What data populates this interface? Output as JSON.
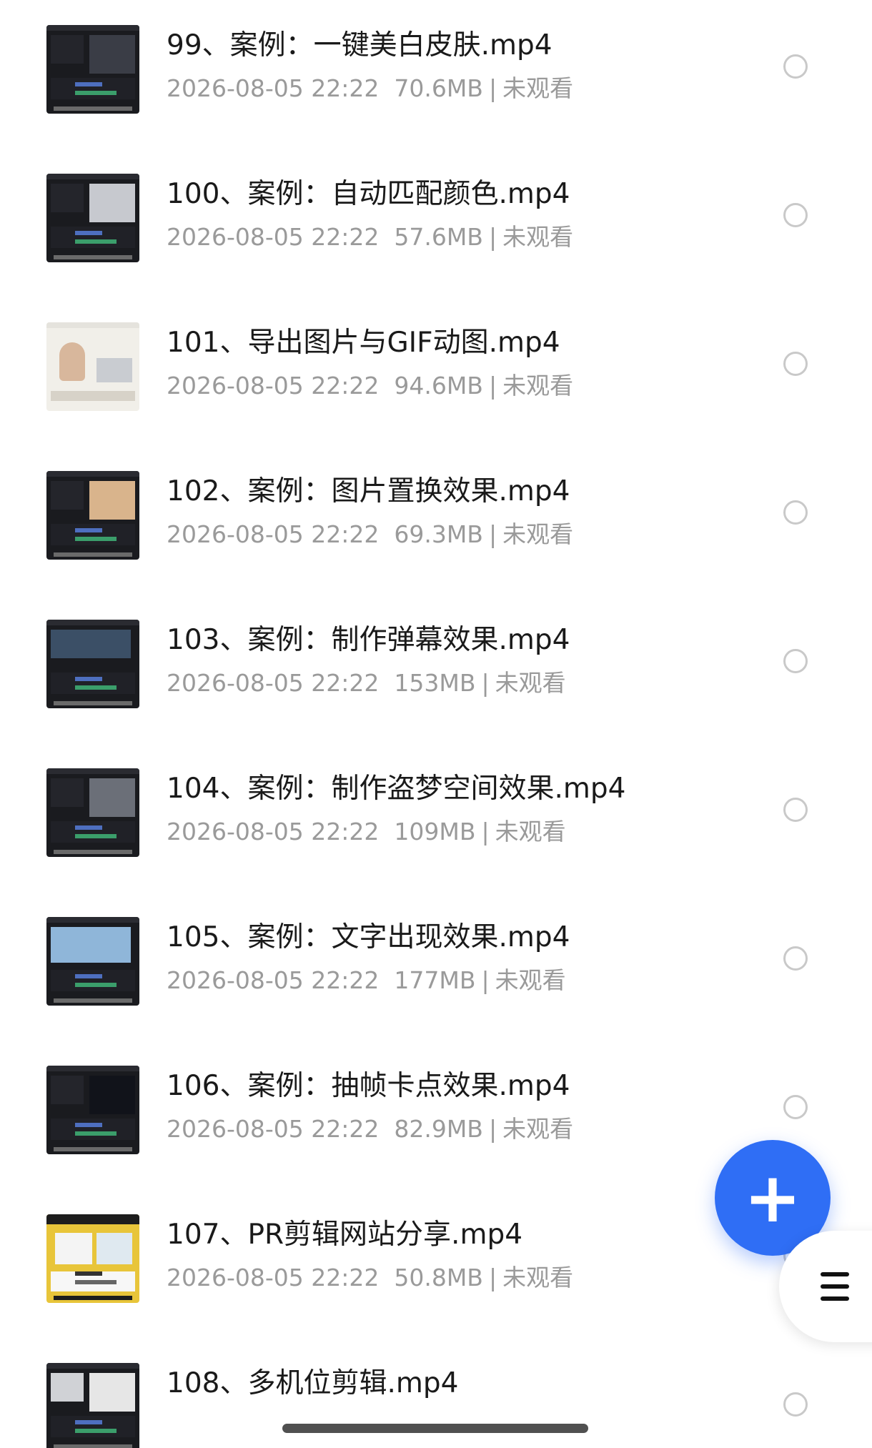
{
  "files": [
    {
      "title": "99、案例：一键美白皮肤.mp4",
      "date": "2026-08-05 22:22",
      "size": "70.6MB",
      "status": "未观看"
    },
    {
      "title": "100、案例：自动匹配颜色.mp4",
      "date": "2026-08-05 22:22",
      "size": "57.6MB",
      "status": "未观看"
    },
    {
      "title": "101、导出图片与GIF动图.mp4",
      "date": "2026-08-05 22:22",
      "size": "94.6MB",
      "status": "未观看"
    },
    {
      "title": "102、案例：图片置换效果.mp4",
      "date": "2026-08-05 22:22",
      "size": "69.3MB",
      "status": "未观看"
    },
    {
      "title": "103、案例：制作弹幕效果.mp4",
      "date": "2026-08-05 22:22",
      "size": "153MB",
      "status": "未观看"
    },
    {
      "title": "104、案例：制作盗梦空间效果.mp4",
      "date": "2026-08-05 22:22",
      "size": "109MB",
      "status": "未观看"
    },
    {
      "title": "105、案例：文字出现效果.mp4",
      "date": "2026-08-05 22:22",
      "size": "177MB",
      "status": "未观看"
    },
    {
      "title": "106、案例：抽帧卡点效果.mp4",
      "date": "2026-08-05 22:22",
      "size": "82.9MB",
      "status": "未观看"
    },
    {
      "title": "107、PR剪辑网站分享.mp4",
      "date": "2026-08-05 22:22",
      "size": "50.8MB",
      "status": "未观看"
    },
    {
      "title": "108、多机位剪辑.mp4",
      "date": "",
      "size": "",
      "status": ""
    }
  ],
  "separator": "|",
  "fab": {
    "label": "+",
    "icon": "plus-icon"
  },
  "side_menu": {
    "icon": "menu-icon"
  },
  "colors": {
    "accent": "#2f6ef5",
    "title_text": "#1a1a1a",
    "meta_text": "#9a9a9a"
  }
}
